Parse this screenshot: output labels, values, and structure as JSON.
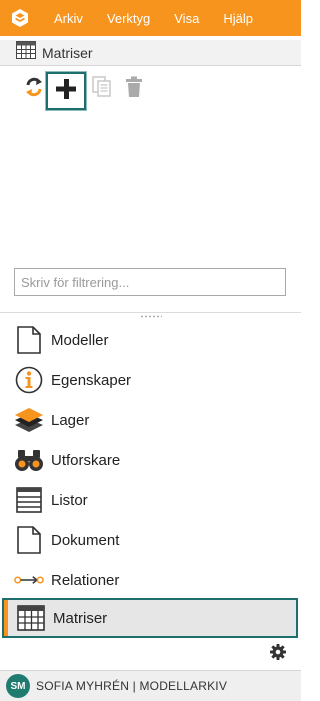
{
  "menu": {
    "items": [
      "Arkiv",
      "Verktyg",
      "Visa",
      "Hjälp"
    ],
    "accent": "#f7941d"
  },
  "panel": {
    "title": "Matriser"
  },
  "toolbar": {
    "icons": [
      "refresh-icon",
      "add-icon",
      "copy-icon",
      "delete-icon"
    ]
  },
  "filter": {
    "placeholder": "Skriv för filtrering...",
    "value": ""
  },
  "nav": {
    "items": [
      {
        "label": "Modeller",
        "icon": "document-icon"
      },
      {
        "label": "Egenskaper",
        "icon": "info-icon"
      },
      {
        "label": "Lager",
        "icon": "layers-icon"
      },
      {
        "label": "Utforskare",
        "icon": "binoculars-icon"
      },
      {
        "label": "Listor",
        "icon": "list-icon"
      },
      {
        "label": "Dokument",
        "icon": "document-icon"
      },
      {
        "label": "Relationer",
        "icon": "relations-icon"
      },
      {
        "label": "Matriser",
        "icon": "grid-icon",
        "active": true
      }
    ]
  },
  "footer": {
    "initials": "SM",
    "user": "SOFIA MYHRÉN | MODELLARKIV",
    "avatar_color": "#1f7a70"
  }
}
